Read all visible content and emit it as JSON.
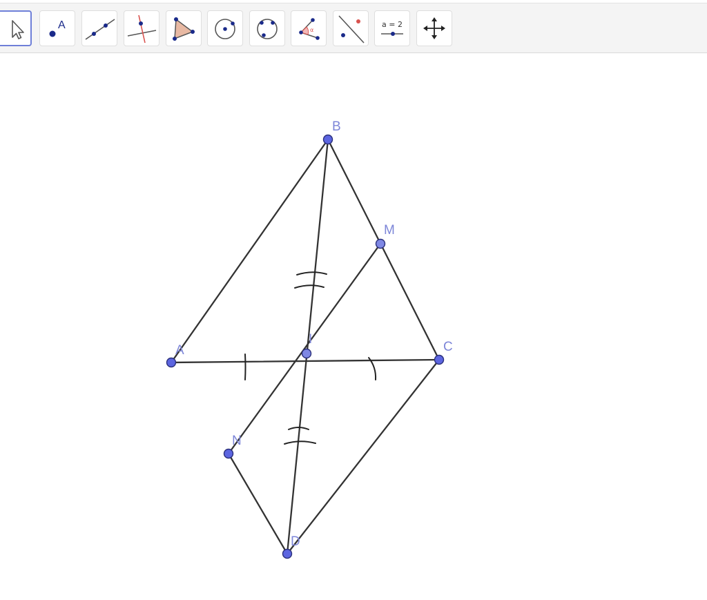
{
  "toolbar": {
    "tools": [
      {
        "name": "move",
        "icon": "arrow-cursor-icon"
      },
      {
        "name": "point",
        "icon": "point-icon",
        "label": "A"
      },
      {
        "name": "line",
        "icon": "line-through-two-points-icon"
      },
      {
        "name": "perpendicular-line",
        "icon": "perpendicular-line-icon"
      },
      {
        "name": "polygon",
        "icon": "polygon-icon"
      },
      {
        "name": "circle-center-point",
        "icon": "circle-center-point-icon"
      },
      {
        "name": "circle-three-points",
        "icon": "circle-three-points-icon"
      },
      {
        "name": "angle",
        "icon": "angle-icon"
      },
      {
        "name": "reflect-about-line",
        "icon": "reflect-line-icon"
      },
      {
        "name": "slider",
        "icon": "slider-icon",
        "label": "a = 2"
      },
      {
        "name": "move-graphics-view",
        "icon": "move-graphics-view-icon"
      }
    ],
    "selected_tool": "move"
  },
  "canvas": {
    "points": {
      "B": {
        "label": "B"
      },
      "M": {
        "label": "M"
      },
      "A": {
        "label": "A"
      },
      "I": {
        "label": "I"
      },
      "C": {
        "label": "C"
      },
      "N": {
        "label": "N"
      },
      "D": {
        "label": "D"
      }
    },
    "colors": {
      "point_fill": "#5c65e0",
      "point_stroke": "#2a2f7a",
      "label": "#7d86d8",
      "segment": "#333333",
      "selected_border": "#6e7fd8"
    }
  }
}
